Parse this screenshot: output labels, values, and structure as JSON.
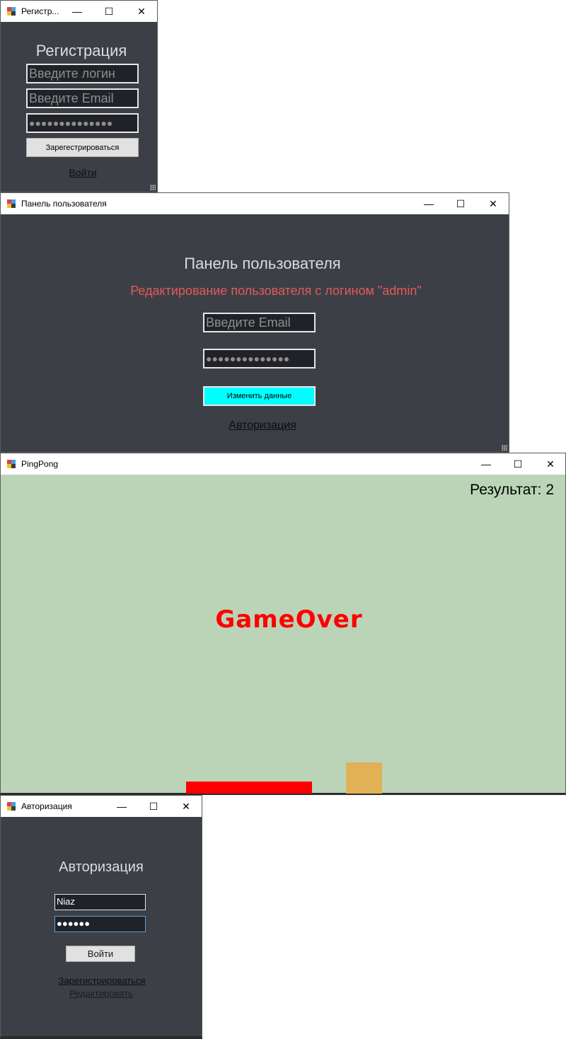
{
  "register_window": {
    "title": "Регистр...",
    "heading": "Регистрация",
    "login_placeholder": "Введите логин",
    "email_placeholder": "Введите Email",
    "password_mask": "●●●●●●●●●●●●●●",
    "register_button": "Зарегестрироваться",
    "login_link": "Войти",
    "controls": {
      "minimize": "—",
      "maximize": "☐",
      "close": "✕"
    }
  },
  "user_panel_window": {
    "title": "Панель пользователя",
    "heading": "Панель пользователя",
    "subheading": "Редактирование пользователя с логином \"admin\"",
    "email_placeholder": "Введите Email",
    "password_mask": "●●●●●●●●●●●●●●",
    "change_button": "Изменить данные",
    "auth_link": "Авторизация",
    "colors": {
      "subheading": "#e05a5a",
      "change_button_bg": "#00ffff"
    },
    "controls": {
      "minimize": "—",
      "maximize": "☐",
      "close": "✕"
    }
  },
  "pingpong_window": {
    "title": "PingPong",
    "score_text": "Результат: 2",
    "game_over_text": "GameOver",
    "colors": {
      "background": "#bbd4b7",
      "game_over": "#ff0000",
      "paddle": "#ff0000",
      "block": "#e2b055"
    },
    "controls": {
      "minimize": "—",
      "maximize": "☐",
      "close": "✕"
    }
  },
  "auth_window": {
    "title": "Авторизация",
    "heading": "Авторизация",
    "login_value": "Niaz",
    "password_mask": "●●●●●●",
    "login_button": "Войти",
    "register_link": "Зарегистрироваться",
    "edit_link": "Редактировать",
    "controls": {
      "minimize": "—",
      "maximize": "☐",
      "close": "✕"
    }
  }
}
